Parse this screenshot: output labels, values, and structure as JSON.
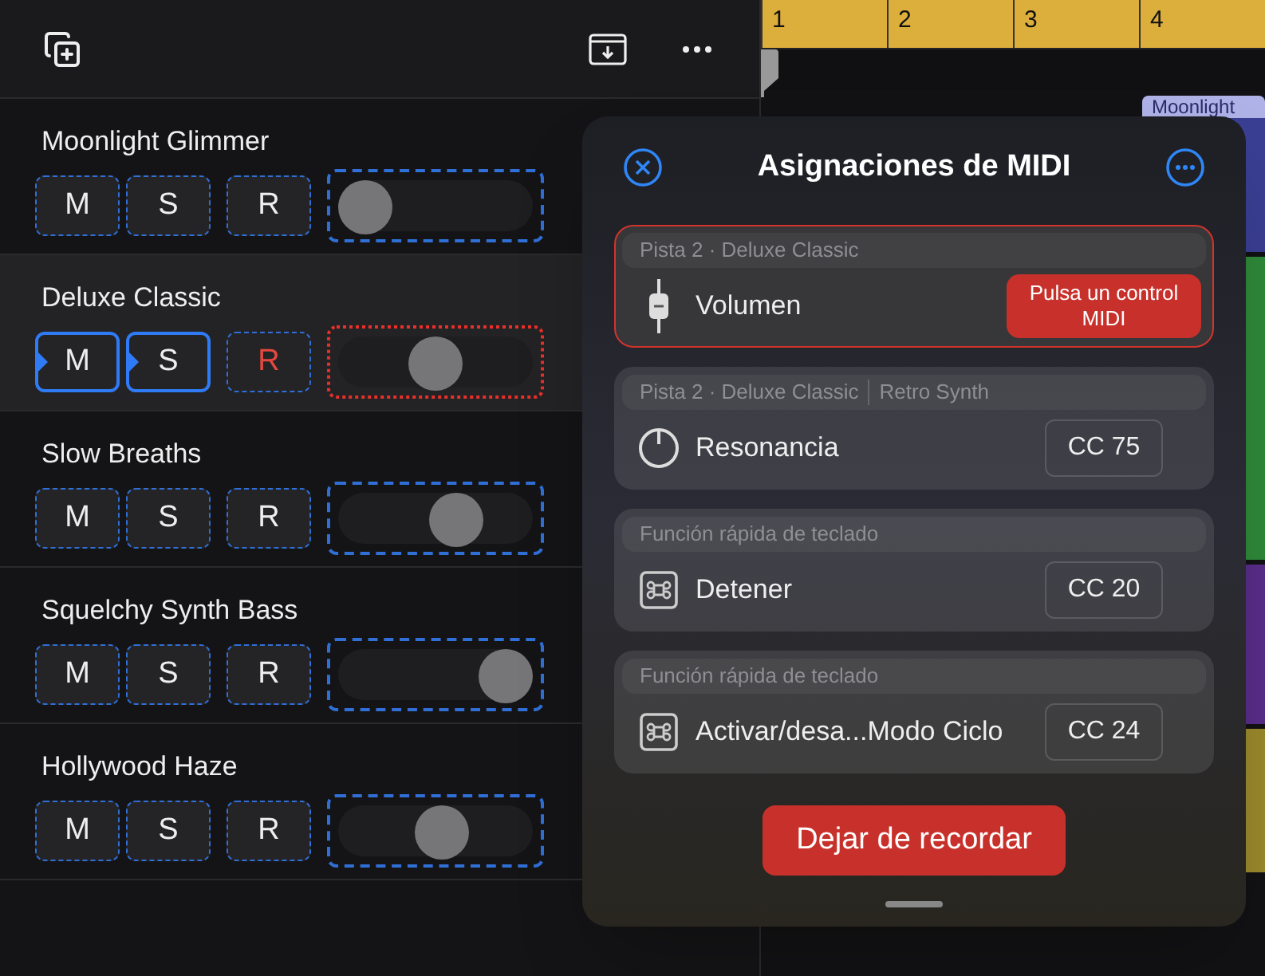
{
  "ruler": {
    "bars": [
      "1",
      "2",
      "3",
      "4"
    ]
  },
  "region": {
    "label": "Moonlight"
  },
  "tracks": [
    {
      "name": "Moonlight Glimmer",
      "selected": false,
      "buttons": [
        {
          "label": "M",
          "assigned": false
        },
        {
          "label": "S",
          "assigned": false
        },
        {
          "label": "R",
          "assigned": false,
          "armed": false
        }
      ],
      "slider": {
        "level": 0.0,
        "learning": false
      }
    },
    {
      "name": "Deluxe Classic",
      "selected": true,
      "buttons": [
        {
          "label": "M",
          "assigned": true
        },
        {
          "label": "S",
          "assigned": true
        },
        {
          "label": "R",
          "assigned": false,
          "armed": true
        }
      ],
      "slider": {
        "level": 0.5,
        "learning": true
      }
    },
    {
      "name": "Slow Breaths",
      "selected": false,
      "buttons": [
        {
          "label": "M",
          "assigned": false
        },
        {
          "label": "S",
          "assigned": false
        },
        {
          "label": "R",
          "assigned": false,
          "armed": false
        }
      ],
      "slider": {
        "level": 0.65,
        "learning": false
      }
    },
    {
      "name": "Squelchy Synth Bass",
      "selected": false,
      "buttons": [
        {
          "label": "M",
          "assigned": false
        },
        {
          "label": "S",
          "assigned": false
        },
        {
          "label": "R",
          "assigned": false,
          "armed": false
        }
      ],
      "slider": {
        "level": 1.0,
        "learning": false
      }
    },
    {
      "name": "Hollywood Haze",
      "selected": false,
      "buttons": [
        {
          "label": "M",
          "assigned": false
        },
        {
          "label": "S",
          "assigned": false
        },
        {
          "label": "R",
          "assigned": false,
          "armed": false
        }
      ],
      "slider": {
        "level": 0.55,
        "learning": false
      }
    }
  ],
  "popover": {
    "title": "Asignaciones de MIDI",
    "assignments": [
      {
        "context": [
          "Pista 2 · Deluxe Classic"
        ],
        "kind": "fader",
        "label": "Volumen",
        "selected": true,
        "action": "Pulsa un control MIDI"
      },
      {
        "context": [
          "Pista 2 · Deluxe Classic",
          "Retro Synth"
        ],
        "kind": "knob",
        "label": "Resonancia",
        "selected": false,
        "cc": "CC 75"
      },
      {
        "context": [
          "Función rápida de teclado"
        ],
        "kind": "command",
        "label": "Detener",
        "selected": false,
        "cc": "CC 20"
      },
      {
        "context": [
          "Función rápida de teclado"
        ],
        "kind": "command",
        "label": "Activar/desa...Modo Ciclo",
        "selected": false,
        "cc": "CC 24"
      }
    ],
    "stop_button": "Dejar de recordar"
  }
}
